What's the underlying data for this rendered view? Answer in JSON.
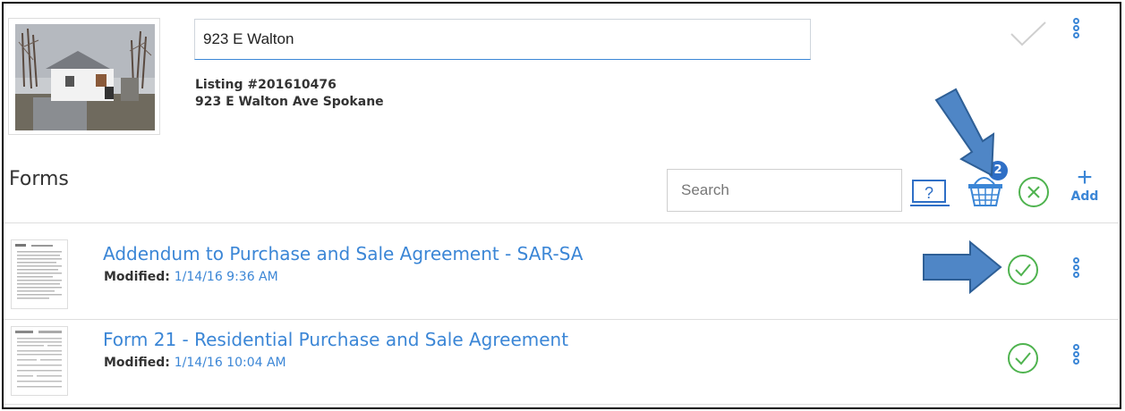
{
  "listing": {
    "address_value": "923 E Walton",
    "listing_number": "Listing #201610476",
    "full_address": "923 E Walton Ave Spokane"
  },
  "forms_section": {
    "title": "Forms",
    "search_placeholder": "Search",
    "help_label": "?",
    "basket_count": "2",
    "add_label": "Add"
  },
  "forms": [
    {
      "title": "Addendum to Purchase and Sale Agreement - SAR-SA",
      "modified_label": "Modified:",
      "modified_date": "1/14/16 9:36 AM"
    },
    {
      "title": "Form 21 - Residential Purchase and Sale Agreement",
      "modified_label": "Modified:",
      "modified_date": "1/14/16 10:04 AM"
    }
  ],
  "colors": {
    "accent_blue": "#3b86d6",
    "check_green": "#4fb34f",
    "arrow_blue": "#4f86c6"
  }
}
